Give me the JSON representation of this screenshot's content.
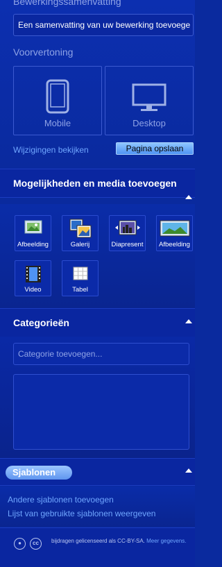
{
  "edit_summary": {
    "label": "Bewerkingssamenvatting",
    "value": "Een samenvatting van uw bewerking toevoege"
  },
  "preview": {
    "label": "Voorvertoning",
    "mobile_label": "Mobile",
    "desktop_label": "Desktop",
    "review_changes_link": "Wijzigingen bekijken",
    "save_button": "Pagina opslaan"
  },
  "media_section": {
    "title": "Mogelijkheden en media toevoegen",
    "items": [
      {
        "label": "Afbeelding",
        "icon": "image-icon"
      },
      {
        "label": "Galerij",
        "icon": "gallery-icon"
      },
      {
        "label": "Diapresent",
        "icon": "slideshow-icon"
      },
      {
        "label": "Afbeelding",
        "icon": "panorama-image-icon"
      },
      {
        "label": "Video",
        "icon": "video-icon"
      },
      {
        "label": "Tabel",
        "icon": "table-icon"
      }
    ]
  },
  "categories_section": {
    "title": "Categorieën",
    "input_placeholder": "Categorie toevoegen..."
  },
  "templates_section": {
    "title": "Sjablonen",
    "add_link": "Andere sjablonen toevoegen",
    "list_link": "Lijst van gebruikte sjablonen weergeven"
  },
  "footer": {
    "license_text": "bijdragen gelicenseerd als CC-BY-SA.",
    "more_link": "Meer gegevens."
  },
  "colors": {
    "background": "#0a2a9e",
    "link": "#6fa6ff",
    "button": "#4f93f3"
  }
}
